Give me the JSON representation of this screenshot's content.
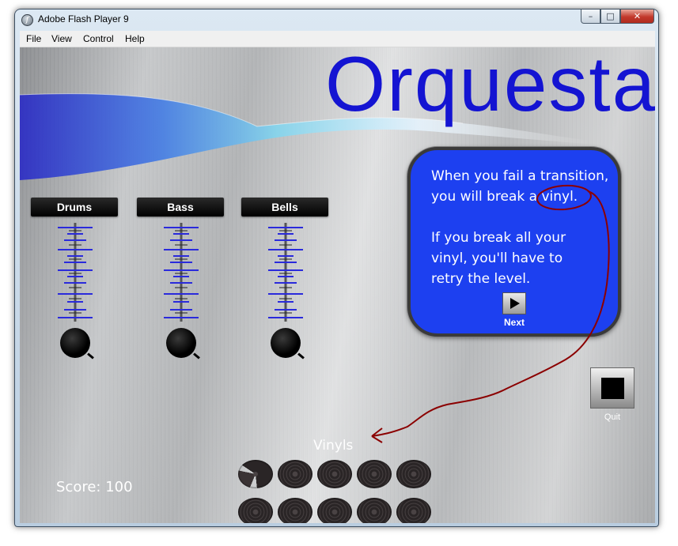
{
  "window": {
    "title": "Adobe Flash Player 9",
    "icon": "flash-icon",
    "app_icon_glyph": "f",
    "controls": {
      "minimize": "–",
      "maximize": "□",
      "close": "✕"
    }
  },
  "menu": {
    "items": [
      "File",
      "View",
      "Control",
      "Help"
    ]
  },
  "game": {
    "title": "Orquesta",
    "channels": [
      {
        "label": "Drums"
      },
      {
        "label": "Bass"
      },
      {
        "label": "Bells"
      }
    ],
    "bubble": {
      "line1": "When you fail a transition,",
      "line2": "you will break a vinyl.",
      "line3": "If you break all your",
      "line4": "vinyl, you'll have to",
      "line5": "retry the level.",
      "next_label": "Next"
    },
    "quit_label": "Quit",
    "vinyls_label": "Vinyls",
    "vinyls": {
      "total": 10,
      "broken": 1
    },
    "score_text": "Score: 100"
  },
  "colors": {
    "title_blue": "#1414d2",
    "bubble_blue": "#1d40f0",
    "annotation_red": "#8b0000"
  }
}
